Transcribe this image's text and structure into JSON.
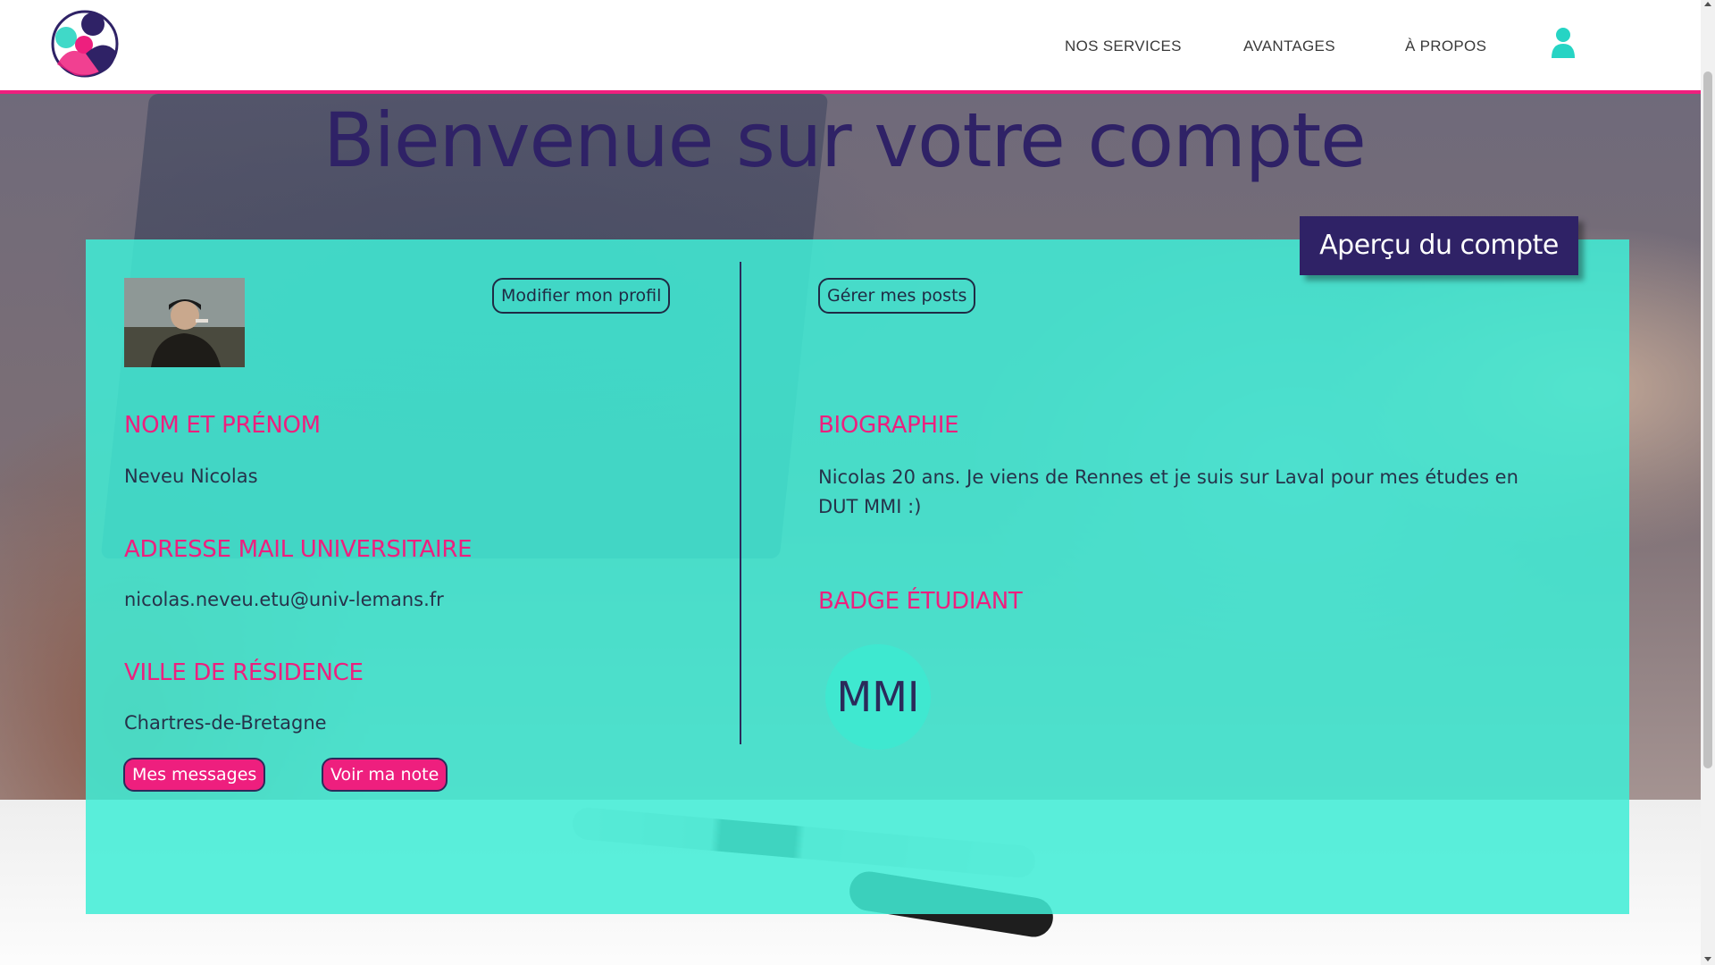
{
  "header": {
    "nav": [
      "NOS SERVICES",
      "AVANTAGES",
      "À PROPOS"
    ]
  },
  "main": {
    "title": "Bienvenue sur votre compte",
    "overview_label": "Aperçu du compte",
    "left": {
      "edit_profile_label": "Modifier mon profil",
      "name_heading": "NOM ET PRÉNOM",
      "name_value": "Neveu Nicolas",
      "email_heading": "ADRESSE MAIL UNIVERSITAIRE",
      "email_value": "nicolas.neveu.etu@univ-lemans.fr",
      "city_heading": "VILLE DE RÉSIDENCE",
      "city_value": "Chartres-de-Bretagne",
      "messages_label": "Mes messages",
      "note_label": "Voir ma note"
    },
    "right": {
      "manage_posts_label": "Gérer mes posts",
      "bio_heading": "BIOGRAPHIE",
      "bio_value": "Nicolas 20 ans. Je viens de Rennes et je suis sur Laval pour mes études en DUT MMI :)",
      "badge_heading": "BADGE ÉTUDIANT",
      "badge_text": "MMI"
    }
  },
  "colors": {
    "accent_pink": "#ee1f7e",
    "title_purple": "#2f2266",
    "panel_teal": "#40eed6",
    "icon_teal": "#26d4c4"
  },
  "icons": {
    "logo": "site-logo",
    "account": "user-icon"
  }
}
